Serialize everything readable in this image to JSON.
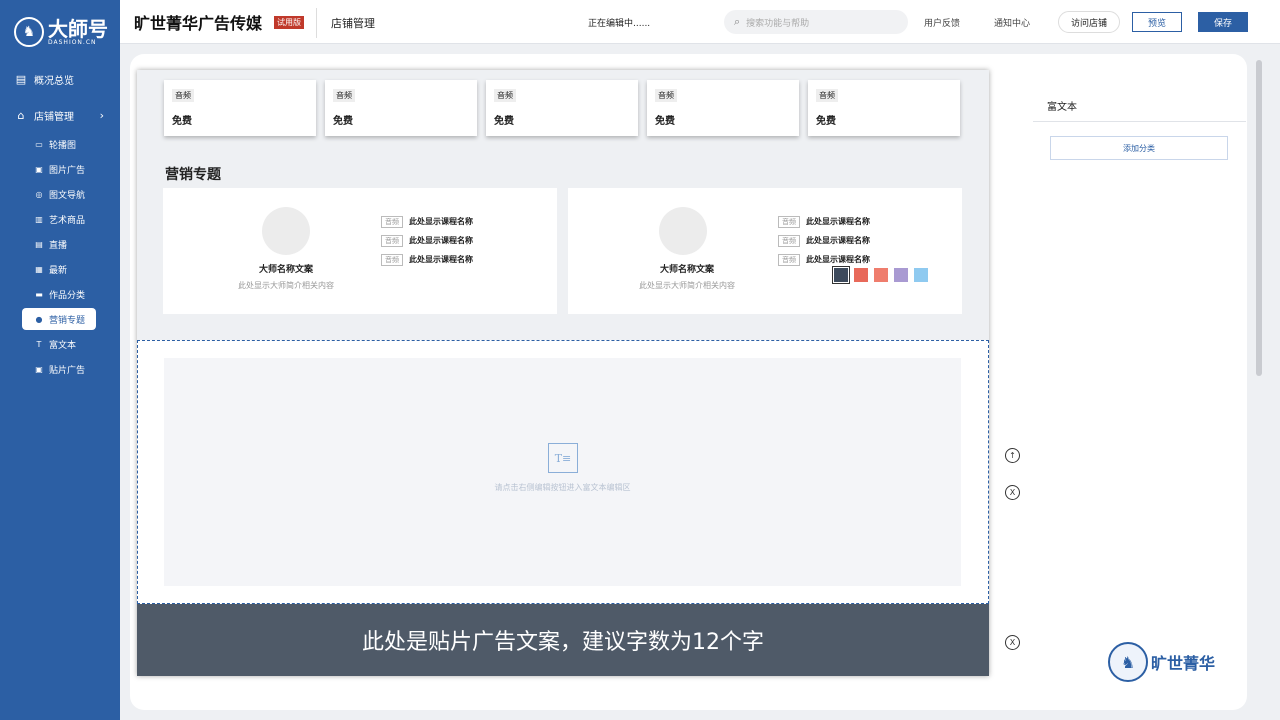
{
  "sidebar": {
    "logo_text": "大師号",
    "logo_sub": "DASHION.CN",
    "overview": "概况总览",
    "store": "店铺管理",
    "items": [
      {
        "label": "轮播图",
        "icon": "carousel-icon",
        "glyph": "▭"
      },
      {
        "label": "图片广告",
        "icon": "image-icon",
        "glyph": "▣"
      },
      {
        "label": "图文导航",
        "icon": "nav-icon",
        "glyph": "◎"
      },
      {
        "label": "艺术商品",
        "icon": "goods-icon",
        "glyph": "▥"
      },
      {
        "label": "直播",
        "icon": "live-icon",
        "glyph": "▤"
      },
      {
        "label": "最新",
        "icon": "new-icon",
        "glyph": "▦"
      },
      {
        "label": "作品分类",
        "icon": "category-icon",
        "glyph": "▬"
      },
      {
        "label": "营销专题",
        "icon": "user-icon",
        "glyph": "●"
      },
      {
        "label": "富文本",
        "icon": "richtext-icon",
        "glyph": "T"
      },
      {
        "label": "贴片广告",
        "icon": "patch-ad-icon",
        "glyph": "▣"
      }
    ],
    "active_index": 7
  },
  "header": {
    "brand": "旷世菁华广告传媒",
    "trial_badge": "试用版",
    "section": "店铺管理",
    "status": "正在编辑中......",
    "search_placeholder": "搜索功能与帮助",
    "feedback": "用户反馈",
    "notifications": "通知中心",
    "visit_store": "访问店铺",
    "preview": "预览",
    "save": "保存"
  },
  "cards": [
    {
      "tag": "音频",
      "price": "免费"
    },
    {
      "tag": "音频",
      "price": "免费"
    },
    {
      "tag": "音频",
      "price": "免费"
    },
    {
      "tag": "音频",
      "price": "免费"
    },
    {
      "tag": "音频",
      "price": "免费"
    }
  ],
  "topic": {
    "title": "营销专题",
    "entries": [
      {
        "master_name": "大师名称文案",
        "master_intro": "此处显示大师简介相关内容",
        "courses": [
          {
            "tag": "音频",
            "name": "此处显示课程名称"
          },
          {
            "tag": "音频",
            "name": "此处显示课程名称"
          },
          {
            "tag": "音频",
            "name": "此处显示课程名称"
          }
        ]
      },
      {
        "master_name": "大师名称文案",
        "master_intro": "此处显示大师简介相关内容",
        "courses": [
          {
            "tag": "音频",
            "name": "此处显示课程名称"
          },
          {
            "tag": "音频",
            "name": "此处显示课程名称"
          },
          {
            "tag": "音频",
            "name": "此处显示课程名称"
          }
        ]
      }
    ],
    "swatches": [
      "#3d4a5c",
      "#e8695a",
      "#ef7d6d",
      "#a99ad2",
      "#8fcaf0"
    ]
  },
  "richtext": {
    "icon_glyph": "T≡",
    "hint": "请点击右侧编辑按钮进入富文本编辑区"
  },
  "ad": {
    "text": "此处是贴片广告文案，建议字数为12个字"
  },
  "controls": {
    "up": "↑",
    "close": "X"
  },
  "right_panel": {
    "title": "富文本",
    "add_category": "添加分类"
  },
  "bottom_logo": {
    "text": "旷世菁华"
  }
}
